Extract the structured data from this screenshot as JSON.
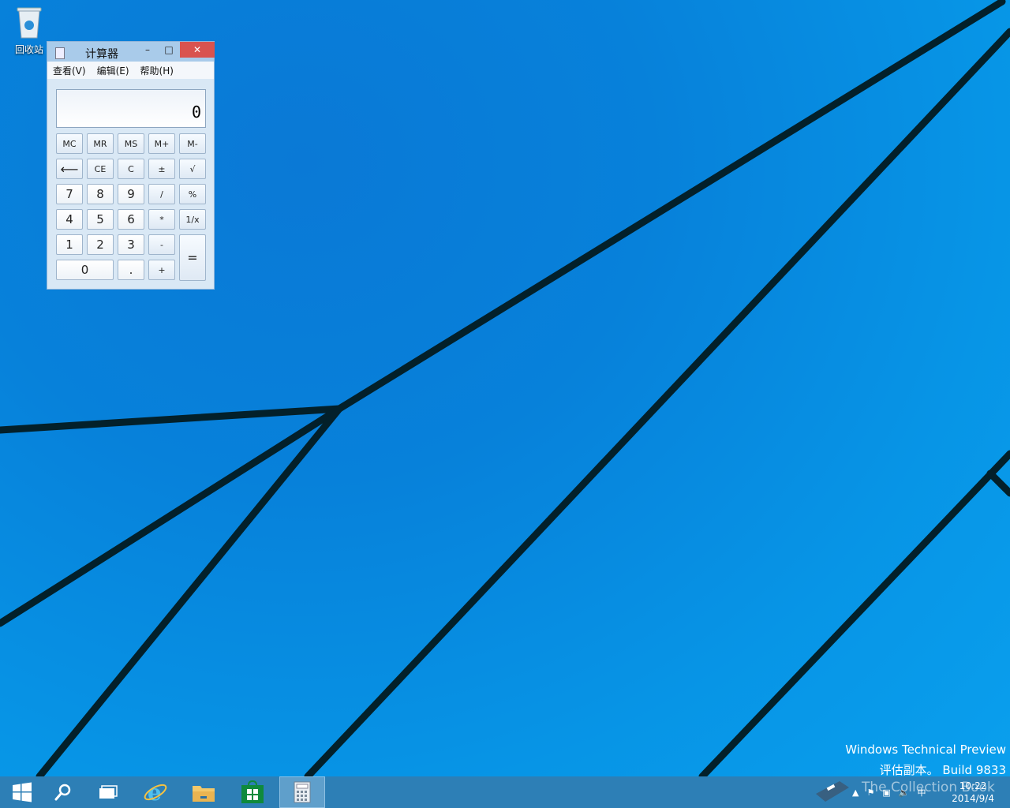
{
  "desktop": {
    "recycle_bin_label": "回收站"
  },
  "calculator": {
    "title": "计算器",
    "minimize": "–",
    "maximize": "□",
    "close": "✕",
    "menu": [
      "查看(V)",
      "编辑(E)",
      "帮助(H)"
    ],
    "display_value": "0",
    "keys": {
      "mc": "MC",
      "mr": "MR",
      "ms": "MS",
      "mplus": "M+",
      "mminus": "M-",
      "back": "⟵",
      "ce": "CE",
      "c": "C",
      "plusminus": "±",
      "sqrt": "√",
      "k7": "7",
      "k8": "8",
      "k9": "9",
      "div": "/",
      "pct": "%",
      "k4": "4",
      "k5": "5",
      "k6": "6",
      "mul": "*",
      "recip": "1/x",
      "k1": "1",
      "k2": "2",
      "k3": "3",
      "minus": "-",
      "equals": "=",
      "k0": "0",
      "dot": ".",
      "plus": "+"
    }
  },
  "watermark": {
    "line1": "Windows Technical Preview",
    "line2": "评估副本。 Build 9833",
    "overlay": "The Collection Book"
  },
  "taskbar": {
    "items": [
      "start-icon",
      "search-icon",
      "task-view-icon",
      "internet-explorer-icon",
      "file-explorer-icon",
      "store-icon",
      "calculator-icon"
    ],
    "ime": "中",
    "time": "10:22",
    "date": "2014/9/4"
  }
}
